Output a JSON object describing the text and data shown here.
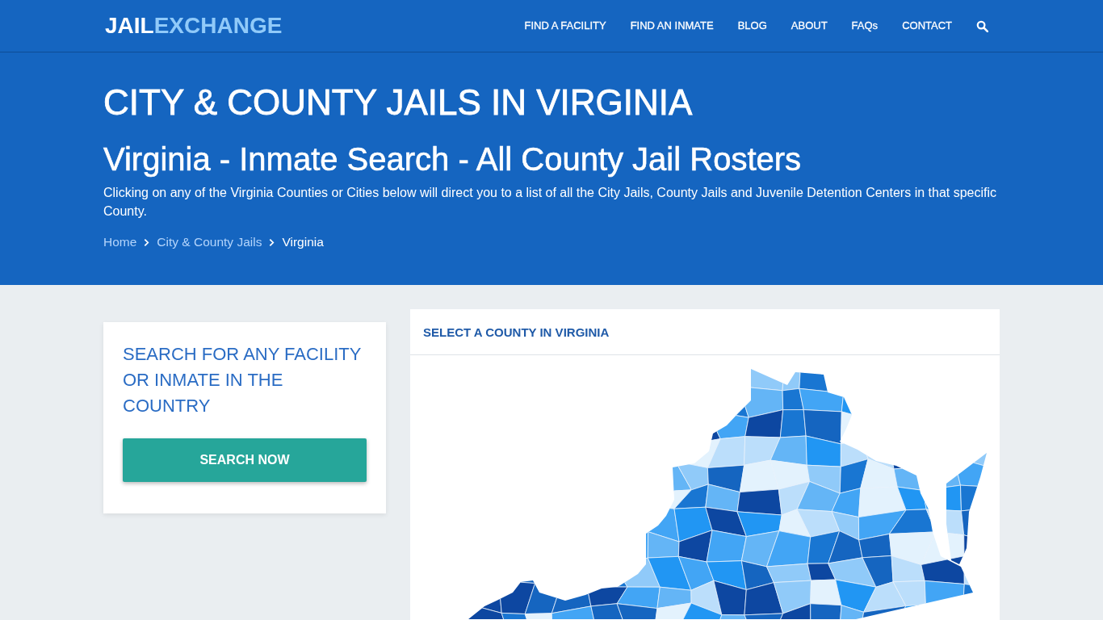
{
  "header": {
    "logo": {
      "first": "JAIL",
      "second": "EXCHANGE"
    },
    "nav": [
      {
        "label": "FIND A FACILITY"
      },
      {
        "label": "FIND AN INMATE"
      },
      {
        "label": "BLOG"
      },
      {
        "label": "ABOUT"
      },
      {
        "label": "FAQs"
      },
      {
        "label": "CONTACT"
      }
    ]
  },
  "hero": {
    "title": "CITY & COUNTY JAILS IN VIRGINIA",
    "subtitle": "Virginia - Inmate Search - All County Jail Rosters",
    "description": "Clicking on any of the Virginia Counties or Cities below will direct you to a list of all the City Jails, County Jails and Juvenile Detention Centers in that specific County.",
    "breadcrumb": [
      {
        "label": "Home",
        "current": false
      },
      {
        "label": "City & County Jails",
        "current": false
      },
      {
        "label": "Virginia",
        "current": true
      }
    ]
  },
  "search_card": {
    "title": "SEARCH FOR ANY FACILITY OR INMATE IN THE COUNTRY",
    "button": "SEARCH NOW"
  },
  "map_card": {
    "title": "SELECT A COUNTY IN VIRGINIA"
  }
}
